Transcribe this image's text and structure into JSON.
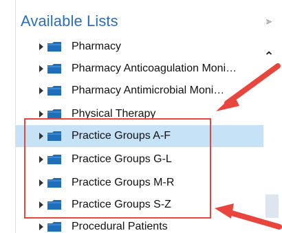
{
  "panel": {
    "title": "Available Lists",
    "collapse_icon": "double-chevron-down-icon",
    "scroll_up_icon": "chevron-up-icon"
  },
  "list": {
    "items": [
      {
        "label": "Pharmacy"
      },
      {
        "label": "Pharmacy Anticoagulation Moni…"
      },
      {
        "label": "Pharmacy Antimicrobial Moni…"
      },
      {
        "label": "Physical Therapy"
      },
      {
        "label": "Practice Groups A-F",
        "selected": true
      },
      {
        "label": "Practice Groups G-L"
      },
      {
        "label": "Practice Groups M-R"
      },
      {
        "label": "Practice Groups S-Z"
      },
      {
        "label": "Procedural Patients"
      }
    ]
  },
  "colors": {
    "title": "#2a6fba",
    "folder": "#1f6fb8",
    "selected_row": "#c6e2f7",
    "annotation": "#e8453c"
  }
}
